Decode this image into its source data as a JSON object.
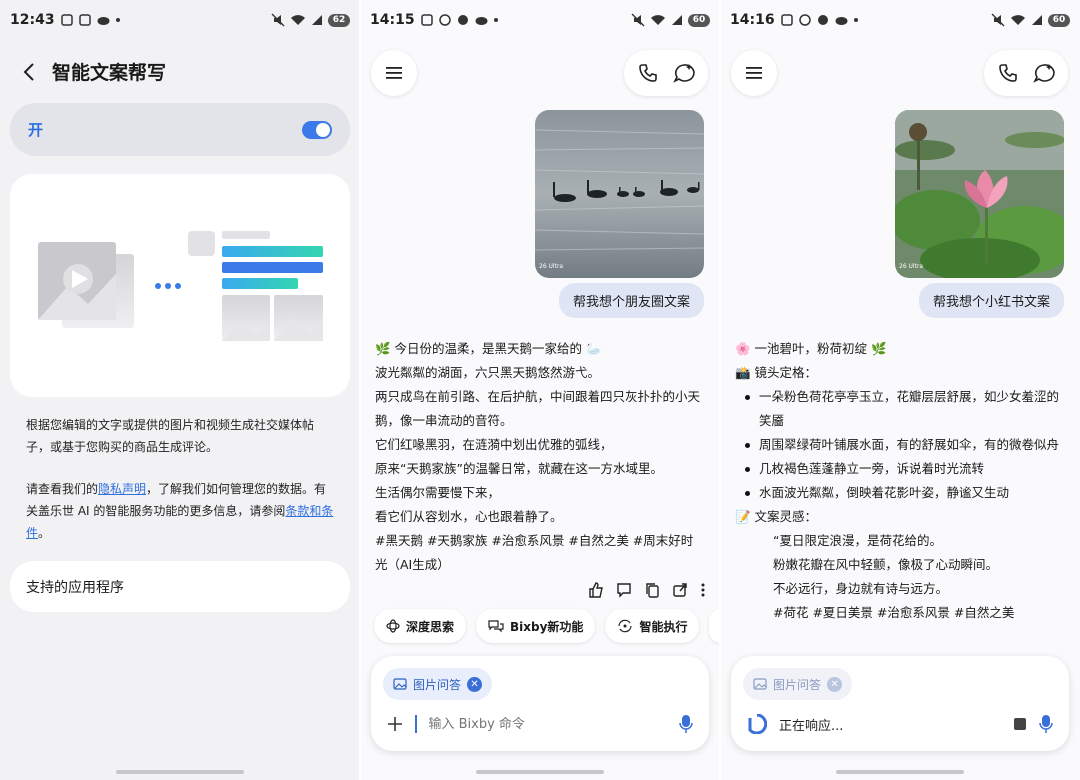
{
  "panel1": {
    "status": {
      "time": "12:43",
      "battery": "62"
    },
    "title": "智能文案帮写",
    "toggle_label": "开",
    "description": "根据您编辑的文字或提供的图片和视频生成社交媒体帖子，或基于您购买的商品生成评论。",
    "privacy": {
      "pre": "请查看我们的",
      "link1": "隐私声明",
      "mid": "，了解我们如何管理您的数据。有关盖乐世 AI 的智能服务功能的更多信息，请参阅",
      "link2": "条款和条件",
      "post": "。"
    },
    "apps_label": "支持的应用程序"
  },
  "panel2": {
    "status": {
      "time": "14:15",
      "battery": "60"
    },
    "user_message": "帮我想个朋友圈文案",
    "photo_watermark": "26 Ultra",
    "response": [
      "🌿 今日份的温柔，是黑天鹅一家给的 🦢",
      "波光粼粼的湖面，六只黑天鹅悠然游弋。",
      "两只成鸟在前引路、在后护航，中间跟着四只灰扑扑的小天鹅，像一串流动的音符。",
      "它们红喙黑羽，在涟漪中划出优雅的弧线，",
      "原来“天鹅家族”的温馨日常，就藏在这一方水域里。",
      "生活偶尔需要慢下来，",
      "看它们从容划水，心也跟着静了。",
      "#黑天鹅 #天鹅家族 #治愈系风景 #自然之美 #周末好时光（AI生成）"
    ],
    "chips": [
      "深度思索",
      "Bixby新功能",
      "智能执行"
    ],
    "tag_chip": "图片问答",
    "input_placeholder": "输入 Bixby 命令"
  },
  "panel3": {
    "status": {
      "time": "14:16",
      "battery": "60"
    },
    "user_message": "帮我想个小红书文案",
    "photo_watermark": "26 Ultra",
    "heading": "🌸 一池碧叶，粉荷初绽 🌿",
    "section1": "📸 镜头定格：",
    "bullets": [
      "一朵粉色荷花亭亭玉立，花瓣层层舒展，如少女羞涩的笑靥",
      "周围翠绿荷叶铺展水面，有的舒展如伞，有的微卷似舟",
      "几枚褐色莲蓬静立一旁，诉说着时光流转",
      "水面波光粼粼，倒映着花影叶姿，静谧又生动"
    ],
    "section2": "📝 文案灵感：",
    "quotes": [
      "“夏日限定浪漫，是荷花给的。",
      "粉嫩花瓣在风中轻颤，像极了心动瞬间。",
      "不必远行，身边就有诗与远方。",
      "#荷花 #夏日美景 #治愈系风景 #自然之美"
    ],
    "tag_chip": "图片问答",
    "responding": "正在响应..."
  },
  "colors": {
    "accent": "#2d6fe0",
    "bubble": "#dfe5f5"
  }
}
